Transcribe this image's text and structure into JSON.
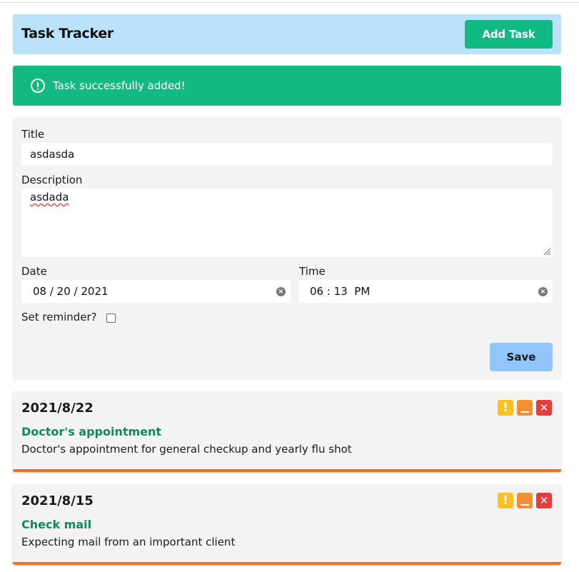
{
  "app": {
    "title": "Task Tracker",
    "add_button": "Add Task"
  },
  "alert": {
    "icon": "exclamation-circle-icon",
    "message": "Task successfully added!"
  },
  "form": {
    "title_label": "Title",
    "title_value": "asdasda",
    "description_label": "Description",
    "description_value": "asdada",
    "date_label": "Date",
    "date_value": "08 / 20 / 2021",
    "time_label": "Time",
    "time_value": "06 : 13  PM",
    "reminder_label": "Set reminder?",
    "reminder_checked": false,
    "save_button": "Save"
  },
  "tasks": [
    {
      "date": "2021/8/22",
      "title": "Doctor's appointment",
      "description": "Doctor's appointment for general checkup and yearly flu shot"
    },
    {
      "date": "2021/8/15",
      "title": "Check mail",
      "description": "Expecting mail from an important client"
    }
  ],
  "task_actions": {
    "important": "!",
    "minimize_icon": "minimize-icon",
    "delete": "✕"
  },
  "colors": {
    "header_bg": "#bae3fb",
    "accent_green": "#10b981",
    "save_blue": "#93c5fd",
    "task_border": "#f5721b",
    "task_title": "#0f8a5f",
    "important": "#fbbf24",
    "minimize": "#f59032",
    "delete": "#e33d3d"
  }
}
